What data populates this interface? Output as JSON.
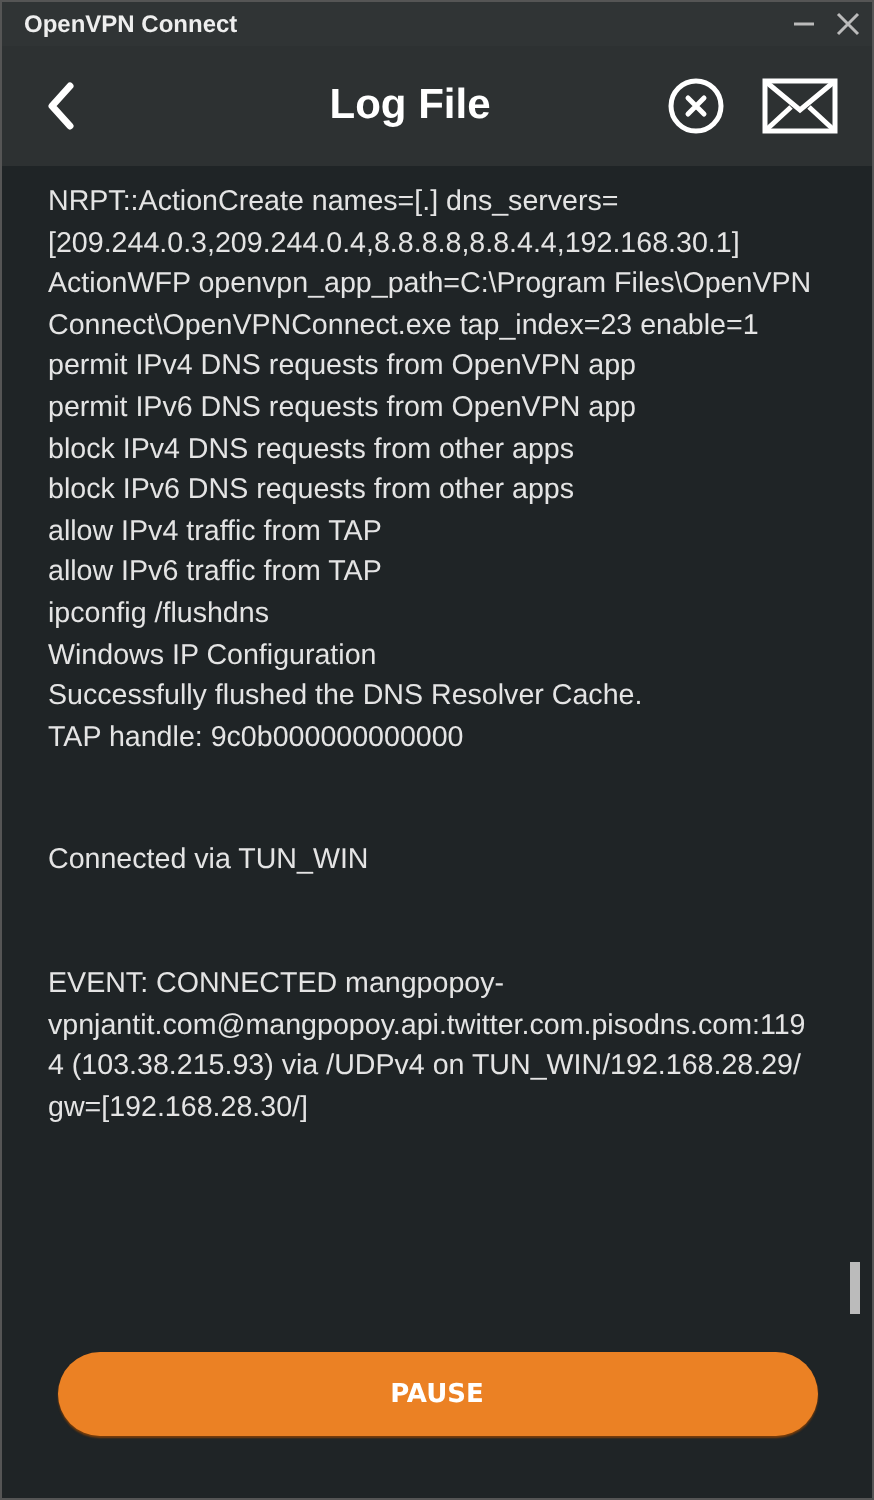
{
  "window": {
    "title": "OpenVPN Connect"
  },
  "header": {
    "title": "Log File"
  },
  "log": {
    "blocks": [
      {
        "lines": [
          "NRPT::ActionCreate names=[.] dns_servers=[209.244.0.3,209.244.0.4,8.8.8.8,8.8.4.4,192.168.30.1]",
          "ActionWFP openvpn_app_path=C:\\Program Files\\OpenVPN Connect\\OpenVPNConnect.exe tap_index=23 enable=1",
          "permit IPv4 DNS requests from OpenVPN app",
          "permit IPv6 DNS requests from OpenVPN app",
          "block IPv4 DNS requests from other apps",
          "block IPv6 DNS requests from other apps",
          "allow IPv4 traffic from TAP",
          "allow IPv6 traffic from TAP",
          "ipconfig /flushdns",
          "Windows IP Configuration",
          "Successfully flushed the DNS Resolver Cache.",
          "TAP handle: 9c0b000000000000"
        ]
      },
      {
        "lines": [
          "Connected via TUN_WIN"
        ]
      },
      {
        "lines": [
          "EVENT: CONNECTED mangpopoy-vpnjantit.com@mangpopoy.api.twitter.com.pisodns.com:1194 (103.38.215.93) via /UDPv4 on TUN_WIN/192.168.28.29/ gw=[192.168.28.30/]"
        ]
      }
    ]
  },
  "button": {
    "label": "PAUSE"
  }
}
